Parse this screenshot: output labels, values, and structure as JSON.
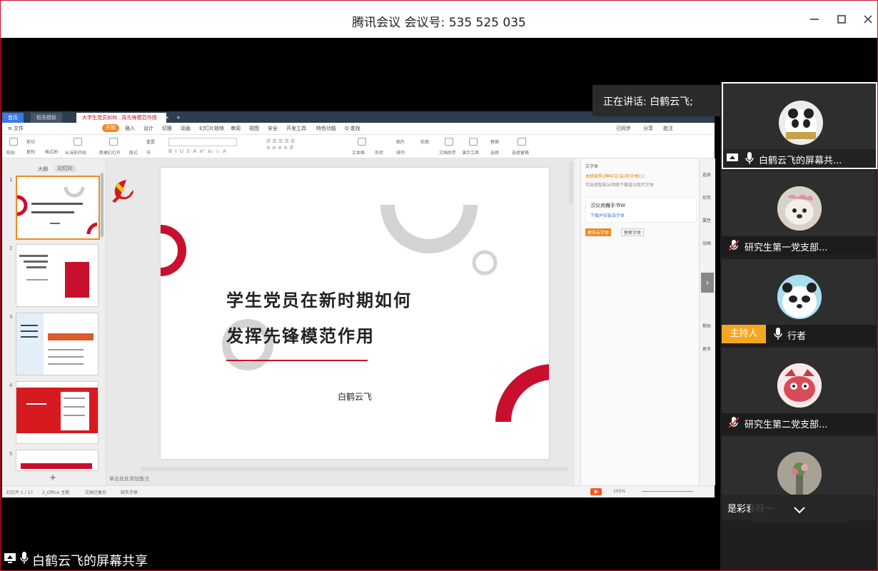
{
  "window": {
    "title": "腾讯会议 会议号: 535 525 035"
  },
  "speaking": {
    "label": "正在讲话: 白鹤云飞;"
  },
  "share": {
    "label": "白鹤云飞的屏幕共享"
  },
  "wps": {
    "tabs": [
      "首页",
      "稻壳模板",
      "大学生党员如何...挥先锋模范作用"
    ],
    "menu": [
      "≡ 文件",
      "开始",
      "插入",
      "设计",
      "切换",
      "动画",
      "幻灯片放映",
      "审阅",
      "视图",
      "安全",
      "开发工具",
      "特色功能",
      "Q 查找"
    ],
    "menu_right": [
      "已同步",
      "分享",
      "批注"
    ],
    "ribbon": [
      "粘贴",
      "剪切",
      "复制",
      "格式刷",
      "从当前开始",
      "新建幻灯片",
      "版式",
      "节",
      "重置",
      "文本框",
      "形状",
      "排列",
      "图片",
      "轮廓",
      "文档助手",
      "演示工具",
      "替换",
      "选择",
      "选择窗格"
    ],
    "thumb_tabs": [
      "大纲",
      "幻灯片"
    ],
    "slide_numbers": [
      "1",
      "2",
      "3",
      "4",
      "5"
    ],
    "slide": {
      "title_line1": "学生党员在新时期如何",
      "title_line2": "发挥先锋模范作用",
      "author": "白鹤云飞"
    },
    "right_panel": {
      "header": "文字体",
      "notice": "本机缺失2种中文(云)的字体(1)",
      "desc": "可选择智能从网络下载或以取代字体",
      "font_name": "汉仪尚巍手书W",
      "font_link": "下载并安装该字体",
      "btn_replace": "更多云字体",
      "btn_ignore": "替换字体"
    },
    "right_sidebar": [
      "选择",
      "形状",
      "属性",
      "动画",
      "帮助",
      "更多"
    ],
    "notes": "单击此处添加备注",
    "status": {
      "slide": "幻灯片 1 / 17",
      "theme": "2_Office 主题",
      "backup": "文档已备份",
      "font": "缺失字体",
      "zoom": "105%"
    }
  },
  "participants": [
    {
      "name": "白鹤云飞的屏幕共...",
      "mic": "on",
      "share": true,
      "host": false,
      "active": true,
      "avatar": "panda"
    },
    {
      "name": "研究生第一党支部...",
      "mic": "muted",
      "share": false,
      "host": false,
      "active": false,
      "avatar": "puppy"
    },
    {
      "name": "行者",
      "mic": "on",
      "share": false,
      "host": true,
      "host_label": "主持人",
      "active": false,
      "avatar": "bear"
    },
    {
      "name": "研究生第二党支部...",
      "mic": "muted",
      "share": false,
      "host": false,
      "active": false,
      "avatar": "cartoon"
    },
    {
      "name": "是彩衰呀～",
      "mic": "none",
      "share": false,
      "host": false,
      "active": false,
      "avatar": "flowers"
    }
  ],
  "colors": {
    "accent_red": "#c8102e",
    "host_orange": "#f5a623",
    "wps_orange": "#f08a24"
  }
}
